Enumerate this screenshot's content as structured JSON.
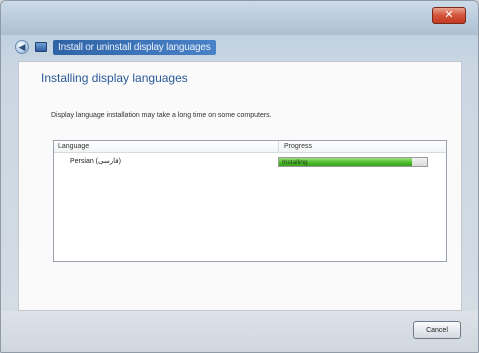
{
  "window": {
    "title": "Install or uninstall display languages"
  },
  "content": {
    "heading": "Installing display languages",
    "info_text": "Display language installation may take a long time on some computers.",
    "table": {
      "columns": [
        "Language",
        "Progress"
      ],
      "rows": [
        {
          "language": "Persian (فارسی)",
          "progress_status": "Installing",
          "progress_fraction": 0.9
        }
      ]
    }
  },
  "footer": {
    "cancel_label": "Cancel"
  },
  "colors": {
    "heading": "#2a5a98",
    "progress_fill": "#4cbe2c",
    "close_button": "#d4533a"
  },
  "icons": {
    "back": "back-arrow-icon",
    "close": "close-icon",
    "app": "language-app-icon"
  }
}
